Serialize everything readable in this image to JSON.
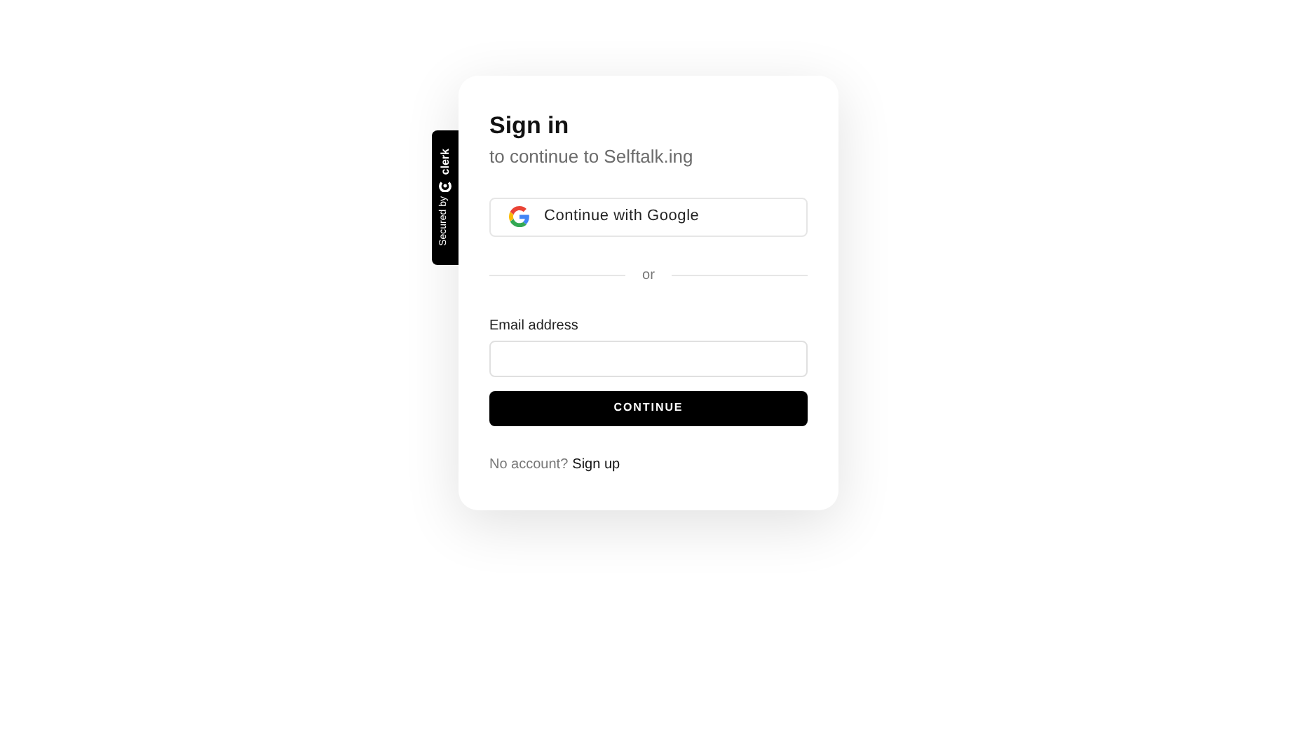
{
  "badge": {
    "secured_by": "Secured by",
    "brand": "clerk"
  },
  "header": {
    "title": "Sign in",
    "subtitle": "to continue to Selftalk.ing"
  },
  "social_button": {
    "label": "Continue with Google"
  },
  "divider": {
    "label": "or"
  },
  "email": {
    "label": "Email address"
  },
  "submit": {
    "label": "CONTINUE"
  },
  "footer": {
    "prompt": "No account?",
    "link": "Sign up"
  }
}
